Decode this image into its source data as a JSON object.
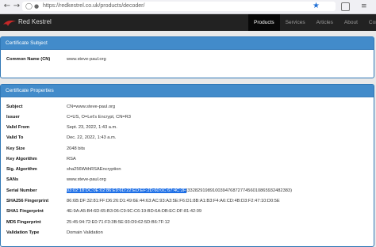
{
  "browser": {
    "url": "https://redkestrel.co.uk/products/decoder/",
    "icons": [
      "back-icon",
      "forward-icon",
      "shield-icon",
      "lock-icon",
      "star-icon",
      "screenshot-icon",
      "menu-icon"
    ]
  },
  "navbar": {
    "brand": "Red Kestrel",
    "items": [
      "Products",
      "Services",
      "Articles",
      "About",
      "Contact"
    ],
    "active": "Products"
  },
  "subject_panel": {
    "title": "Certificate Subject",
    "rows": [
      {
        "key": "Common Name (CN)",
        "value": "www.steve-paul.org"
      }
    ]
  },
  "properties_panel": {
    "title": "Certificate Properties",
    "rows": [
      {
        "key": "Subject",
        "value": "CN=www.steve-paul.org"
      },
      {
        "key": "Issuer",
        "value": "C=US, O=Let's Encrypt, CN=R3"
      },
      {
        "key": "Valid From",
        "value": "Sept. 23, 2022, 1:43 a.m."
      },
      {
        "key": "Valid To",
        "value": "Dec. 22, 2022, 1:43 a.m."
      },
      {
        "key": "Key Size",
        "value": "2048 bits"
      },
      {
        "key": "Key Algorithm",
        "value": "RSA"
      },
      {
        "key": "Sig. Algorithm",
        "value": "sha256WithRSAEncryption"
      },
      {
        "key": "SANs",
        "value": "www.steve-paul.org"
      },
      {
        "key": "Serial Number",
        "value": "(33282919891003947687277456010865932482383)",
        "highlight": "03:02:18:DC:0E:02:86:E9:6D:22:ED:EF:2D:60:0C:67:4C:2F"
      },
      {
        "key": "SHA256 Fingerprint",
        "value": "86:6B:DF:32:81:FF:D6:26:D1:49:6E:44:63:AC:93:A3:5E:F6:D1:8B:A1:B3:F4:A6:CD:4B:D3:F2:47:10:D0:5E"
      },
      {
        "key": "SHA1 Fingerprint",
        "value": "4E:9A:A5:B4:6D:65:B3:06:C9:9C:C6:19:BD:6A:DB:EC:DF:81:42:09"
      },
      {
        "key": "MD5 Fingerprint",
        "value": "25:45:94:72:E0:71:F3:3B:5E:93:D9:62:5D:B6:7F:12"
      },
      {
        "key": "Validation Type",
        "value": "Domain Validation"
      }
    ]
  }
}
